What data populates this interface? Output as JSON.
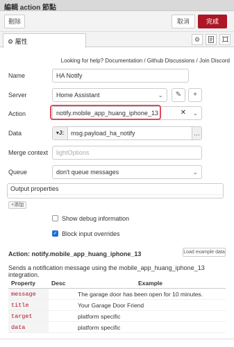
{
  "window": {
    "title": "編輯 action 節點"
  },
  "toolbar": {
    "delete_label": "刪除",
    "cancel_label": "取消",
    "done_label": "完成"
  },
  "tabs": {
    "properties_label": "屬性"
  },
  "help": {
    "prefix": "Looking for help?",
    "documentation": "Documentation",
    "sep1": "/",
    "github": "Github Discussions",
    "sep2": "/",
    "discord": "Join Discord"
  },
  "form": {
    "name": {
      "label": "Name",
      "value": "HA Notify"
    },
    "server": {
      "label": "Server",
      "value": "Home Assistant"
    },
    "action": {
      "label": "Action",
      "value": "notify.mobile_app_huang_iphone_13"
    },
    "data": {
      "label": "Data",
      "type_badge": "J:",
      "value": "msg.payload_ha_notify"
    },
    "merge_context": {
      "label": "Merge context",
      "placeholder": "lightOptions"
    },
    "queue": {
      "label": "Queue",
      "value": "don't queue messages"
    },
    "output_properties": {
      "label": "Output properties",
      "add_label": "添加"
    },
    "show_debug": {
      "label": "Show debug information",
      "checked": false
    },
    "block_input": {
      "label": "Block input overrides",
      "checked": true
    }
  },
  "action_info": {
    "title": "Action: notify.mobile_app_huang_iphone_13",
    "load_example_label": "Load example data",
    "description": "Sends a notification message using the mobile_app_huang_iphone_13 integration.",
    "columns": [
      "Property",
      "Desc",
      "Example"
    ],
    "rows": [
      {
        "property": "message",
        "desc": "",
        "example": "The garage door has been open for 10 minutes."
      },
      {
        "property": "title",
        "desc": "",
        "example": "Your Garage Door Friend"
      },
      {
        "property": "target",
        "desc": "",
        "example": "platform specific"
      },
      {
        "property": "data",
        "desc": "",
        "example": "platform specific"
      }
    ]
  },
  "icons": {
    "settings": "gear-icon",
    "description": "document-icon",
    "appearance": "frame-icon",
    "edit": "pencil-icon",
    "add": "plus-icon",
    "clear": "x-icon",
    "dropdown": "chevron-down-icon",
    "type_toggle": "caret-down-icon",
    "more": "ellipsis-icon"
  }
}
